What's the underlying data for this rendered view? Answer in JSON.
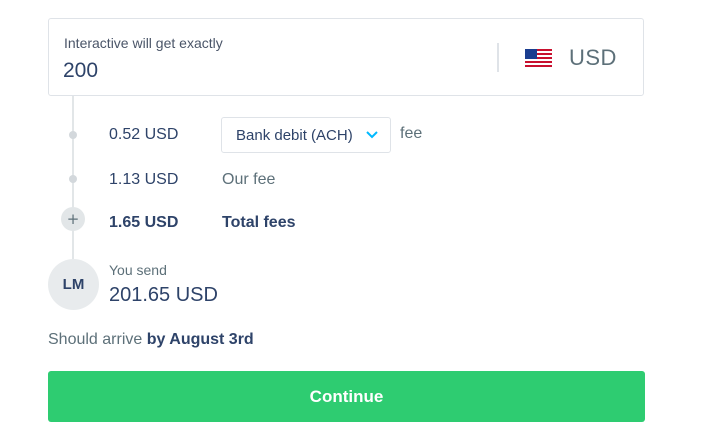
{
  "recipient_amount": {
    "label": "Interactive will get exactly",
    "value": "200",
    "currency": "USD",
    "flag_icon": "us-flag-icon"
  },
  "fees": {
    "method_fee_amount": "0.52 USD",
    "method_selected": "Bank debit (ACH)",
    "method_suffix": "fee",
    "our_fee_amount": "1.13 USD",
    "our_fee_label": "Our fee",
    "total_amount": "1.65 USD",
    "total_label": "Total fees",
    "plus_symbol": "+"
  },
  "sender": {
    "initials": "LM",
    "label": "You send",
    "value": "201.65 USD"
  },
  "arrival": {
    "prefix": "Should arrive",
    "date": "by August 3rd"
  },
  "actions": {
    "continue_label": "Continue"
  },
  "colors": {
    "accent": "#2ecc71",
    "text_primary": "#2e4369",
    "text_secondary": "#5d7079",
    "chevron": "#00b9ff"
  }
}
